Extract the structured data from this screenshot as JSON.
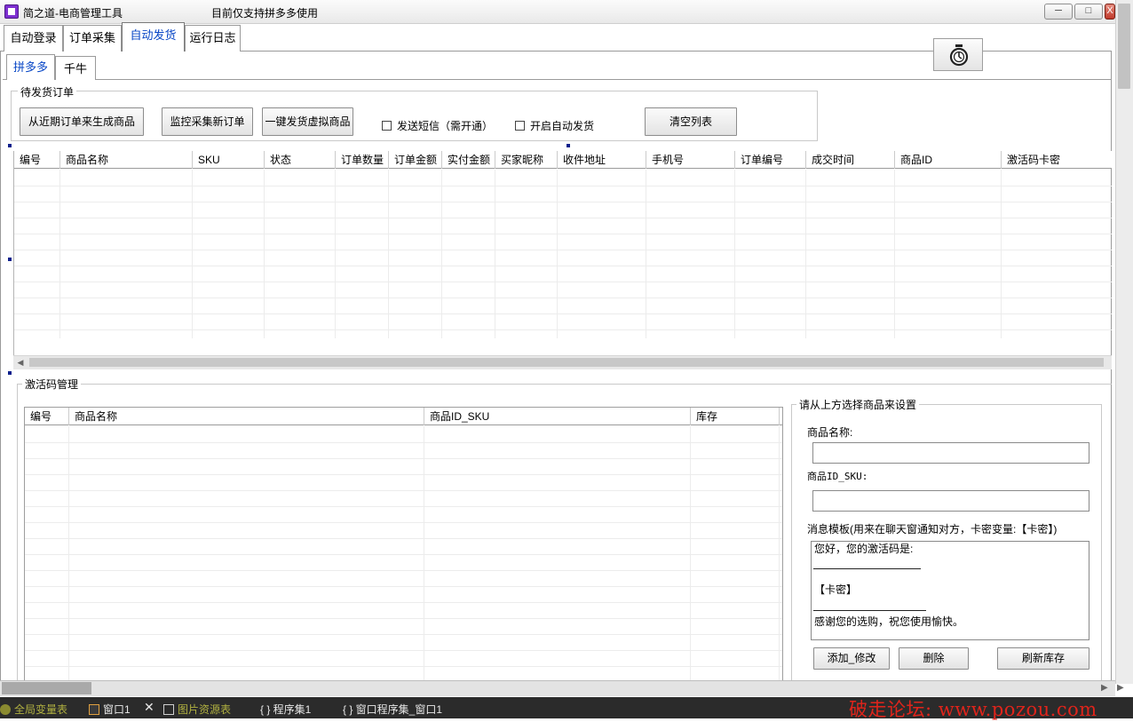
{
  "window": {
    "title": "简之道-电商管理工具",
    "notice": "目前仅支持拼多多使用",
    "min_glyph": "─",
    "max_glyph": "□",
    "close_glyph": "X"
  },
  "tabs": [
    "自动登录",
    "订单采集",
    "自动发货",
    "运行日志"
  ],
  "active_tab": "自动发货",
  "subtabs": [
    "拼多多",
    "千牛"
  ],
  "active_subtab": "拼多多",
  "pending": {
    "title": "待发货订单",
    "btn_generate": "从近期订单来生成商品",
    "btn_monitor": "监控采集新订单",
    "btn_ship": "一键发货虚拟商品",
    "chk_sms": "发送短信（需开通）",
    "chk_auto": "开启自动发货",
    "btn_clear": "清空列表"
  },
  "orders_columns": [
    "编号",
    "商品名称",
    "SKU",
    "状态",
    "订单数量",
    "订单金额",
    "实付金额",
    "买家昵称",
    "收件地址",
    "手机号",
    "订单编号",
    "成交时间",
    "商品ID",
    "激活码卡密"
  ],
  "codes": {
    "title": "激活码管理",
    "columns": [
      "编号",
      "商品名称",
      "商品ID_SKU",
      "库存"
    ]
  },
  "settings": {
    "title": "请从上方选择商品来设置",
    "name_label": "商品名称:",
    "name_value": "",
    "sku_label": "商品ID_SKU:",
    "sku_value": "",
    "template_label": "消息模板(用来在聊天窗通知对方，卡密变量:【卡密】)",
    "template_lines": [
      "您好，您的激活码是:",
      "【卡密】",
      "感谢您的选购，祝您使用愉快。"
    ],
    "btn_add": "添加_修改",
    "btn_delete": "删除",
    "btn_refresh": "刷新库存"
  },
  "taskbar": {
    "globals": "全局变量表",
    "window": "窗口1",
    "images": "图片资源表",
    "program": "{ } 程序集1",
    "window_program": "{ } 窗口程序集_窗口1",
    "close_glyph": "✕"
  },
  "watermark": "破走论坛:  www.pozou.com",
  "colors": {
    "active_tab_text": "#0645c6",
    "watermark": "#e0241b",
    "app_icon": "#7d2fd0",
    "taskbar_bg": "#2b2b2b"
  }
}
